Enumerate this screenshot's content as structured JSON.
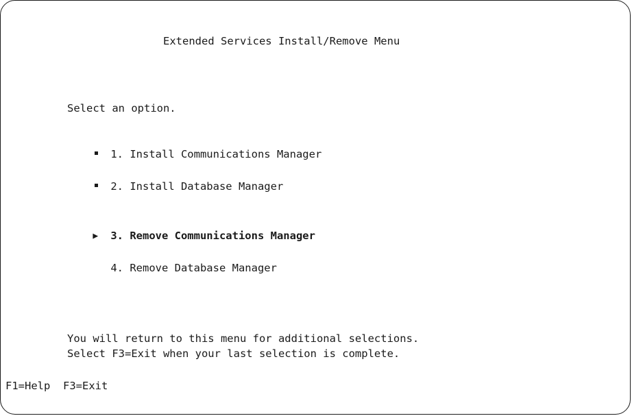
{
  "menu": {
    "title": "Extended Services Install/Remove Menu",
    "prompt": "Select an option.",
    "options": [
      {
        "label": "1. Install Communications Manager",
        "marker": "square-bullet-icon"
      },
      {
        "label": "2. Install Database Manager",
        "marker": "square-bullet-icon"
      },
      {
        "label": "3. Remove Communications Manager",
        "marker": "pointer-arrow-icon",
        "selected": true
      },
      {
        "label": "4. Remove Database Manager",
        "marker": "none"
      }
    ],
    "info_line_1": "You will return to this menu for additional selections.",
    "info_line_2": "Select F3=Exit when your last selection is complete."
  },
  "function_keys": {
    "help": "F1=Help",
    "exit": "F3=Exit"
  }
}
